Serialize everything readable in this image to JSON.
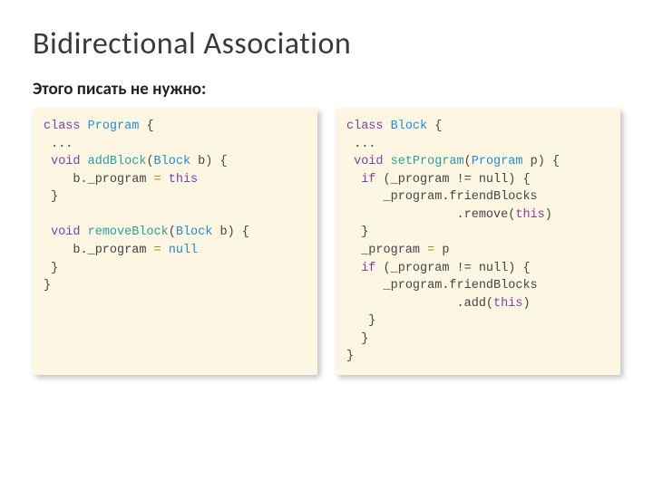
{
  "title": "Bidirectional Association",
  "subtitle": "Этого писать не нужно:",
  "left": {
    "kw_class": "class",
    "cls": "Program",
    "dots": "...",
    "kw_void1": "void",
    "m1": "addBlock",
    "p1_type": "Block",
    "p1_name": "b",
    "body1_lhs": "b._program",
    "op_eq": "=",
    "body1_rhs": "this",
    "kw_void2": "void",
    "m2": "removeBlock",
    "p2_type": "Block",
    "p2_name": "b",
    "body2_lhs": "b._program",
    "body2_rhs": "null"
  },
  "right": {
    "kw_class": "class",
    "cls": "Block",
    "dots": "...",
    "kw_void": "void",
    "m": "setProgram",
    "p_type": "Program",
    "p_name": "p",
    "kw_if": "if",
    "cond1": "(_program != null)",
    "l1": "_program.friendBlocks",
    "l2": ".remove(",
    "l2_this": "this",
    "l2_end": ")",
    "assign_lhs": "_program",
    "op_eq": "=",
    "assign_rhs": "p",
    "cond2": "(_program != null)",
    "l3": "_program.friendBlocks",
    "l4": ".add(",
    "l4_this": "this",
    "l4_end": ")"
  }
}
